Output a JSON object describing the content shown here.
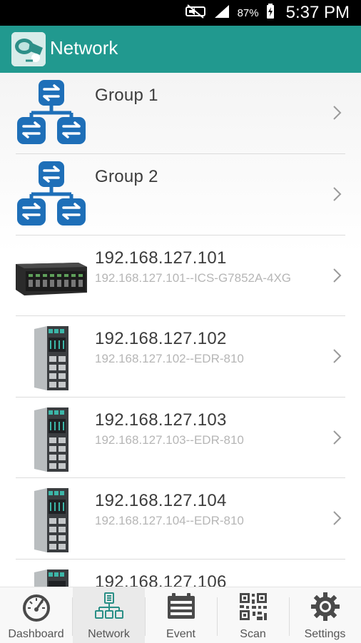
{
  "status_bar": {
    "battery_percent": "87%",
    "time": "5:37 PM"
  },
  "app_bar": {
    "title": "Network"
  },
  "list": {
    "items": [
      {
        "line1": "Group 1",
        "line2": "",
        "icon": "group-network-icon"
      },
      {
        "line1": "Group 2",
        "line2": "",
        "icon": "group-network-icon"
      },
      {
        "line1": "192.168.127.101",
        "line2": "192.168.127.101--ICS-G7852A-4XG",
        "icon": "rack-switch-icon"
      },
      {
        "line1": "192.168.127.102",
        "line2": "192.168.127.102--EDR-810",
        "icon": "din-rail-router-icon"
      },
      {
        "line1": "192.168.127.103",
        "line2": "192.168.127.103--EDR-810",
        "icon": "din-rail-router-icon"
      },
      {
        "line1": "192.168.127.104",
        "line2": "192.168.127.104--EDR-810",
        "icon": "din-rail-router-icon"
      },
      {
        "line1": "192.168.127.106",
        "line2": "",
        "icon": "din-rail-router-icon"
      }
    ]
  },
  "bottom_nav": {
    "tabs": [
      {
        "label": "Dashboard",
        "icon": "speedometer-icon"
      },
      {
        "label": "Network",
        "icon": "network-tree-icon",
        "active": true
      },
      {
        "label": "Event",
        "icon": "event-list-icon"
      },
      {
        "label": "Scan",
        "icon": "qr-code-icon"
      },
      {
        "label": "Settings",
        "icon": "gear-icon"
      }
    ]
  },
  "colors": {
    "app_bar": "#21998f",
    "group_icon": "#1e6fb8",
    "active_tab_icon": "#2a8f86"
  }
}
